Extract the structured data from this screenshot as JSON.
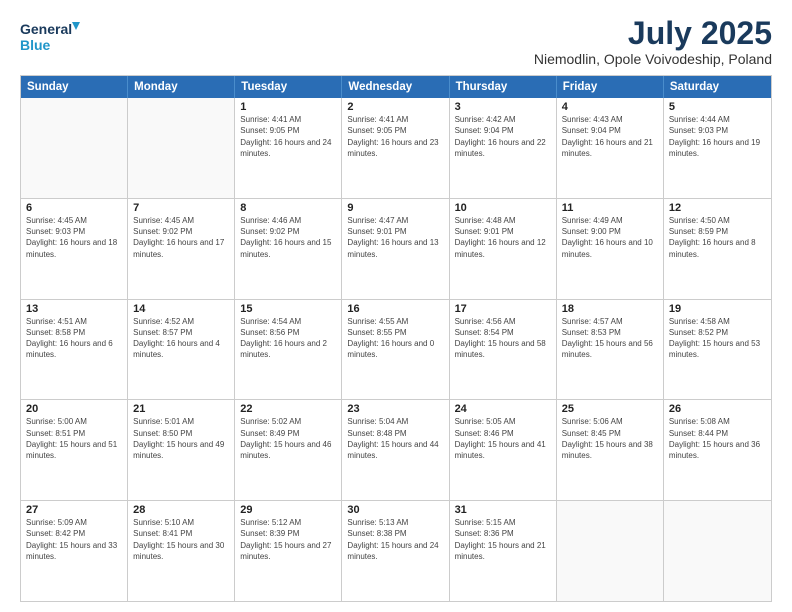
{
  "header": {
    "logo_line1": "General",
    "logo_line2": "Blue",
    "title": "July 2025",
    "subtitle": "Niemodlin, Opole Voivodeship, Poland"
  },
  "calendar": {
    "days_of_week": [
      "Sunday",
      "Monday",
      "Tuesday",
      "Wednesday",
      "Thursday",
      "Friday",
      "Saturday"
    ],
    "weeks": [
      [
        {
          "day": "",
          "info": ""
        },
        {
          "day": "",
          "info": ""
        },
        {
          "day": "1",
          "info": "Sunrise: 4:41 AM\nSunset: 9:05 PM\nDaylight: 16 hours and 24 minutes."
        },
        {
          "day": "2",
          "info": "Sunrise: 4:41 AM\nSunset: 9:05 PM\nDaylight: 16 hours and 23 minutes."
        },
        {
          "day": "3",
          "info": "Sunrise: 4:42 AM\nSunset: 9:04 PM\nDaylight: 16 hours and 22 minutes."
        },
        {
          "day": "4",
          "info": "Sunrise: 4:43 AM\nSunset: 9:04 PM\nDaylight: 16 hours and 21 minutes."
        },
        {
          "day": "5",
          "info": "Sunrise: 4:44 AM\nSunset: 9:03 PM\nDaylight: 16 hours and 19 minutes."
        }
      ],
      [
        {
          "day": "6",
          "info": "Sunrise: 4:45 AM\nSunset: 9:03 PM\nDaylight: 16 hours and 18 minutes."
        },
        {
          "day": "7",
          "info": "Sunrise: 4:45 AM\nSunset: 9:02 PM\nDaylight: 16 hours and 17 minutes."
        },
        {
          "day": "8",
          "info": "Sunrise: 4:46 AM\nSunset: 9:02 PM\nDaylight: 16 hours and 15 minutes."
        },
        {
          "day": "9",
          "info": "Sunrise: 4:47 AM\nSunset: 9:01 PM\nDaylight: 16 hours and 13 minutes."
        },
        {
          "day": "10",
          "info": "Sunrise: 4:48 AM\nSunset: 9:01 PM\nDaylight: 16 hours and 12 minutes."
        },
        {
          "day": "11",
          "info": "Sunrise: 4:49 AM\nSunset: 9:00 PM\nDaylight: 16 hours and 10 minutes."
        },
        {
          "day": "12",
          "info": "Sunrise: 4:50 AM\nSunset: 8:59 PM\nDaylight: 16 hours and 8 minutes."
        }
      ],
      [
        {
          "day": "13",
          "info": "Sunrise: 4:51 AM\nSunset: 8:58 PM\nDaylight: 16 hours and 6 minutes."
        },
        {
          "day": "14",
          "info": "Sunrise: 4:52 AM\nSunset: 8:57 PM\nDaylight: 16 hours and 4 minutes."
        },
        {
          "day": "15",
          "info": "Sunrise: 4:54 AM\nSunset: 8:56 PM\nDaylight: 16 hours and 2 minutes."
        },
        {
          "day": "16",
          "info": "Sunrise: 4:55 AM\nSunset: 8:55 PM\nDaylight: 16 hours and 0 minutes."
        },
        {
          "day": "17",
          "info": "Sunrise: 4:56 AM\nSunset: 8:54 PM\nDaylight: 15 hours and 58 minutes."
        },
        {
          "day": "18",
          "info": "Sunrise: 4:57 AM\nSunset: 8:53 PM\nDaylight: 15 hours and 56 minutes."
        },
        {
          "day": "19",
          "info": "Sunrise: 4:58 AM\nSunset: 8:52 PM\nDaylight: 15 hours and 53 minutes."
        }
      ],
      [
        {
          "day": "20",
          "info": "Sunrise: 5:00 AM\nSunset: 8:51 PM\nDaylight: 15 hours and 51 minutes."
        },
        {
          "day": "21",
          "info": "Sunrise: 5:01 AM\nSunset: 8:50 PM\nDaylight: 15 hours and 49 minutes."
        },
        {
          "day": "22",
          "info": "Sunrise: 5:02 AM\nSunset: 8:49 PM\nDaylight: 15 hours and 46 minutes."
        },
        {
          "day": "23",
          "info": "Sunrise: 5:04 AM\nSunset: 8:48 PM\nDaylight: 15 hours and 44 minutes."
        },
        {
          "day": "24",
          "info": "Sunrise: 5:05 AM\nSunset: 8:46 PM\nDaylight: 15 hours and 41 minutes."
        },
        {
          "day": "25",
          "info": "Sunrise: 5:06 AM\nSunset: 8:45 PM\nDaylight: 15 hours and 38 minutes."
        },
        {
          "day": "26",
          "info": "Sunrise: 5:08 AM\nSunset: 8:44 PM\nDaylight: 15 hours and 36 minutes."
        }
      ],
      [
        {
          "day": "27",
          "info": "Sunrise: 5:09 AM\nSunset: 8:42 PM\nDaylight: 15 hours and 33 minutes."
        },
        {
          "day": "28",
          "info": "Sunrise: 5:10 AM\nSunset: 8:41 PM\nDaylight: 15 hours and 30 minutes."
        },
        {
          "day": "29",
          "info": "Sunrise: 5:12 AM\nSunset: 8:39 PM\nDaylight: 15 hours and 27 minutes."
        },
        {
          "day": "30",
          "info": "Sunrise: 5:13 AM\nSunset: 8:38 PM\nDaylight: 15 hours and 24 minutes."
        },
        {
          "day": "31",
          "info": "Sunrise: 5:15 AM\nSunset: 8:36 PM\nDaylight: 15 hours and 21 minutes."
        },
        {
          "day": "",
          "info": ""
        },
        {
          "day": "",
          "info": ""
        }
      ]
    ]
  }
}
